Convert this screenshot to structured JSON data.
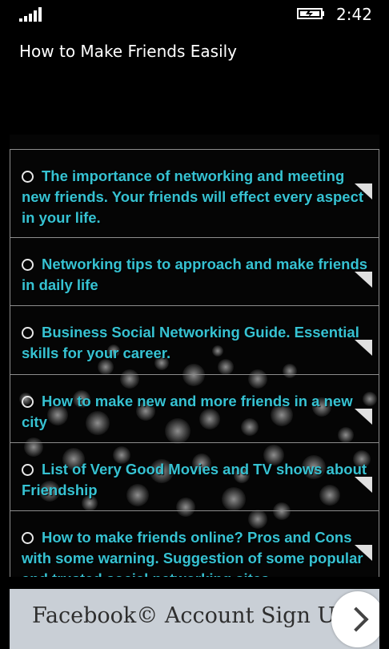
{
  "status_bar": {
    "clock": "2:42",
    "signal_icon": "signal-bars-icon",
    "battery_icon": "battery-charging-icon"
  },
  "app": {
    "title": "How to Make Friends Easily"
  },
  "list": {
    "items": [
      {
        "label": "The importance of networking and meeting new friends. Your friends will effect every aspect in your life."
      },
      {
        "label": "Networking tips to approach and make friends in daily life"
      },
      {
        "label": "Business Social Networking Guide. Essential skills for your career."
      },
      {
        "label": "How to make new and more friends in a new city"
      },
      {
        "label": "List of Very Good Movies and TV shows about Friendship"
      },
      {
        "label": "How to make friends online? Pros and Cons with some warning. Suggestion of some popular and trusted social networking sites"
      }
    ],
    "item_icon": "radio-circle-icon",
    "arrow_icon": "corner-arrow-icon",
    "text_color": "#36c2d2"
  },
  "banner": {
    "label": "Facebook© Account Sign Up",
    "button_icon": "chevron-right-icon",
    "background": "#c9cfd6"
  }
}
